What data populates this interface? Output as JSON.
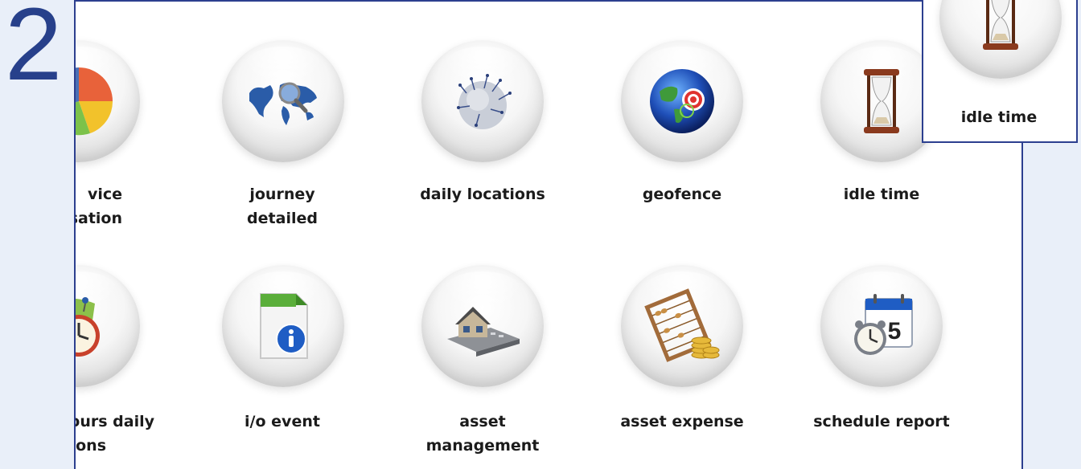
{
  "step_number": "2",
  "row1": [
    {
      "line1": "vice",
      "line2": "sation",
      "icon": "pie-chart-icon"
    },
    {
      "line1": "journey",
      "line2": "detailed",
      "icon": "world-map-magnifier-icon"
    },
    {
      "line1": "daily locations",
      "line2": "",
      "icon": "globe-pins-icon"
    },
    {
      "line1": "geofence",
      "line2": "",
      "icon": "globe-target-icon"
    },
    {
      "line1": "idle time",
      "line2": "",
      "icon": "hourglass-icon"
    }
  ],
  "row2": [
    {
      "line1": "ours daily",
      "line2": "tions",
      "icon": "map-clock-icon"
    },
    {
      "line1": "i/o event",
      "line2": "",
      "icon": "info-document-icon"
    },
    {
      "line1": "asset",
      "line2": "management",
      "icon": "house-calculator-icon"
    },
    {
      "line1": "asset expense",
      "line2": "",
      "icon": "abacus-coins-icon"
    },
    {
      "line1": "schedule report",
      "line2": "",
      "icon": "calendar-clock-icon"
    }
  ],
  "callout": {
    "label": "idle time",
    "icon": "hourglass-icon"
  },
  "colors": {
    "accent": "#2c3f8f",
    "step_number": "#27408b",
    "background": "#e9eff9"
  }
}
